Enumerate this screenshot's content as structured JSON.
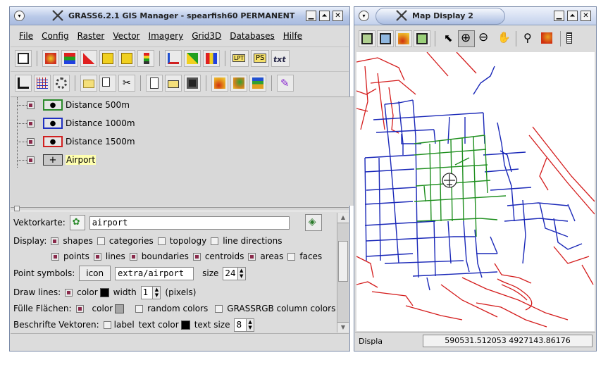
{
  "gm": {
    "title": "GRASS6.2.1 GIS Manager - spearfish60 PERMANENT",
    "menus": [
      "File",
      "Config",
      "Raster",
      "Vector",
      "Imagery",
      "Grid3D",
      "Databases",
      "Hilfe"
    ],
    "layers": [
      {
        "label": "Distance 500m",
        "color": "#2a8a2a"
      },
      {
        "label": "Distance 1000m",
        "color": "#2030c0"
      },
      {
        "label": "Distance 1500m",
        "color": "#d02020"
      },
      {
        "label": "Airport",
        "color": "#333333"
      }
    ],
    "tools": {
      "ps_text": "PS",
      "txt_text": "txt",
      "lpt_text": "LPT"
    },
    "props": {
      "vektorkarte_label": "Vektorkarte:",
      "map_name": "airport",
      "display_label": "Display:",
      "shapes": "shapes",
      "categories": "categories",
      "topology": "topology",
      "line_directions": "line directions",
      "points": "points",
      "lines": "lines",
      "boundaries": "boundaries",
      "centroids": "centroids",
      "areas": "areas",
      "faces": "faces",
      "point_symbols_label": "Point symbols:",
      "icon_button": "icon",
      "symbol_value": "extra/airport",
      "size_label": "size",
      "size_value": "24",
      "draw_lines_label": "Draw lines:",
      "color_label": "color",
      "width_label": "width",
      "width_value": "1",
      "pixels_label": "(pixels)",
      "fill_label": "Fülle Flächen:",
      "random_colors": "random colors",
      "grassrgb": "GRASSRGB column colors",
      "label_vectors": "Beschrifte Vektoren:",
      "label_label": "label",
      "text_color": "text color",
      "text_size": "text size",
      "text_size_value": "8"
    }
  },
  "md": {
    "title": "Map Display 2",
    "status_label": "Displa",
    "coordinates": "590531.512053 4927143.86176"
  },
  "colors": {
    "green": "#1f8f1f",
    "blue": "#1a28b8",
    "red": "#d41c1c"
  }
}
